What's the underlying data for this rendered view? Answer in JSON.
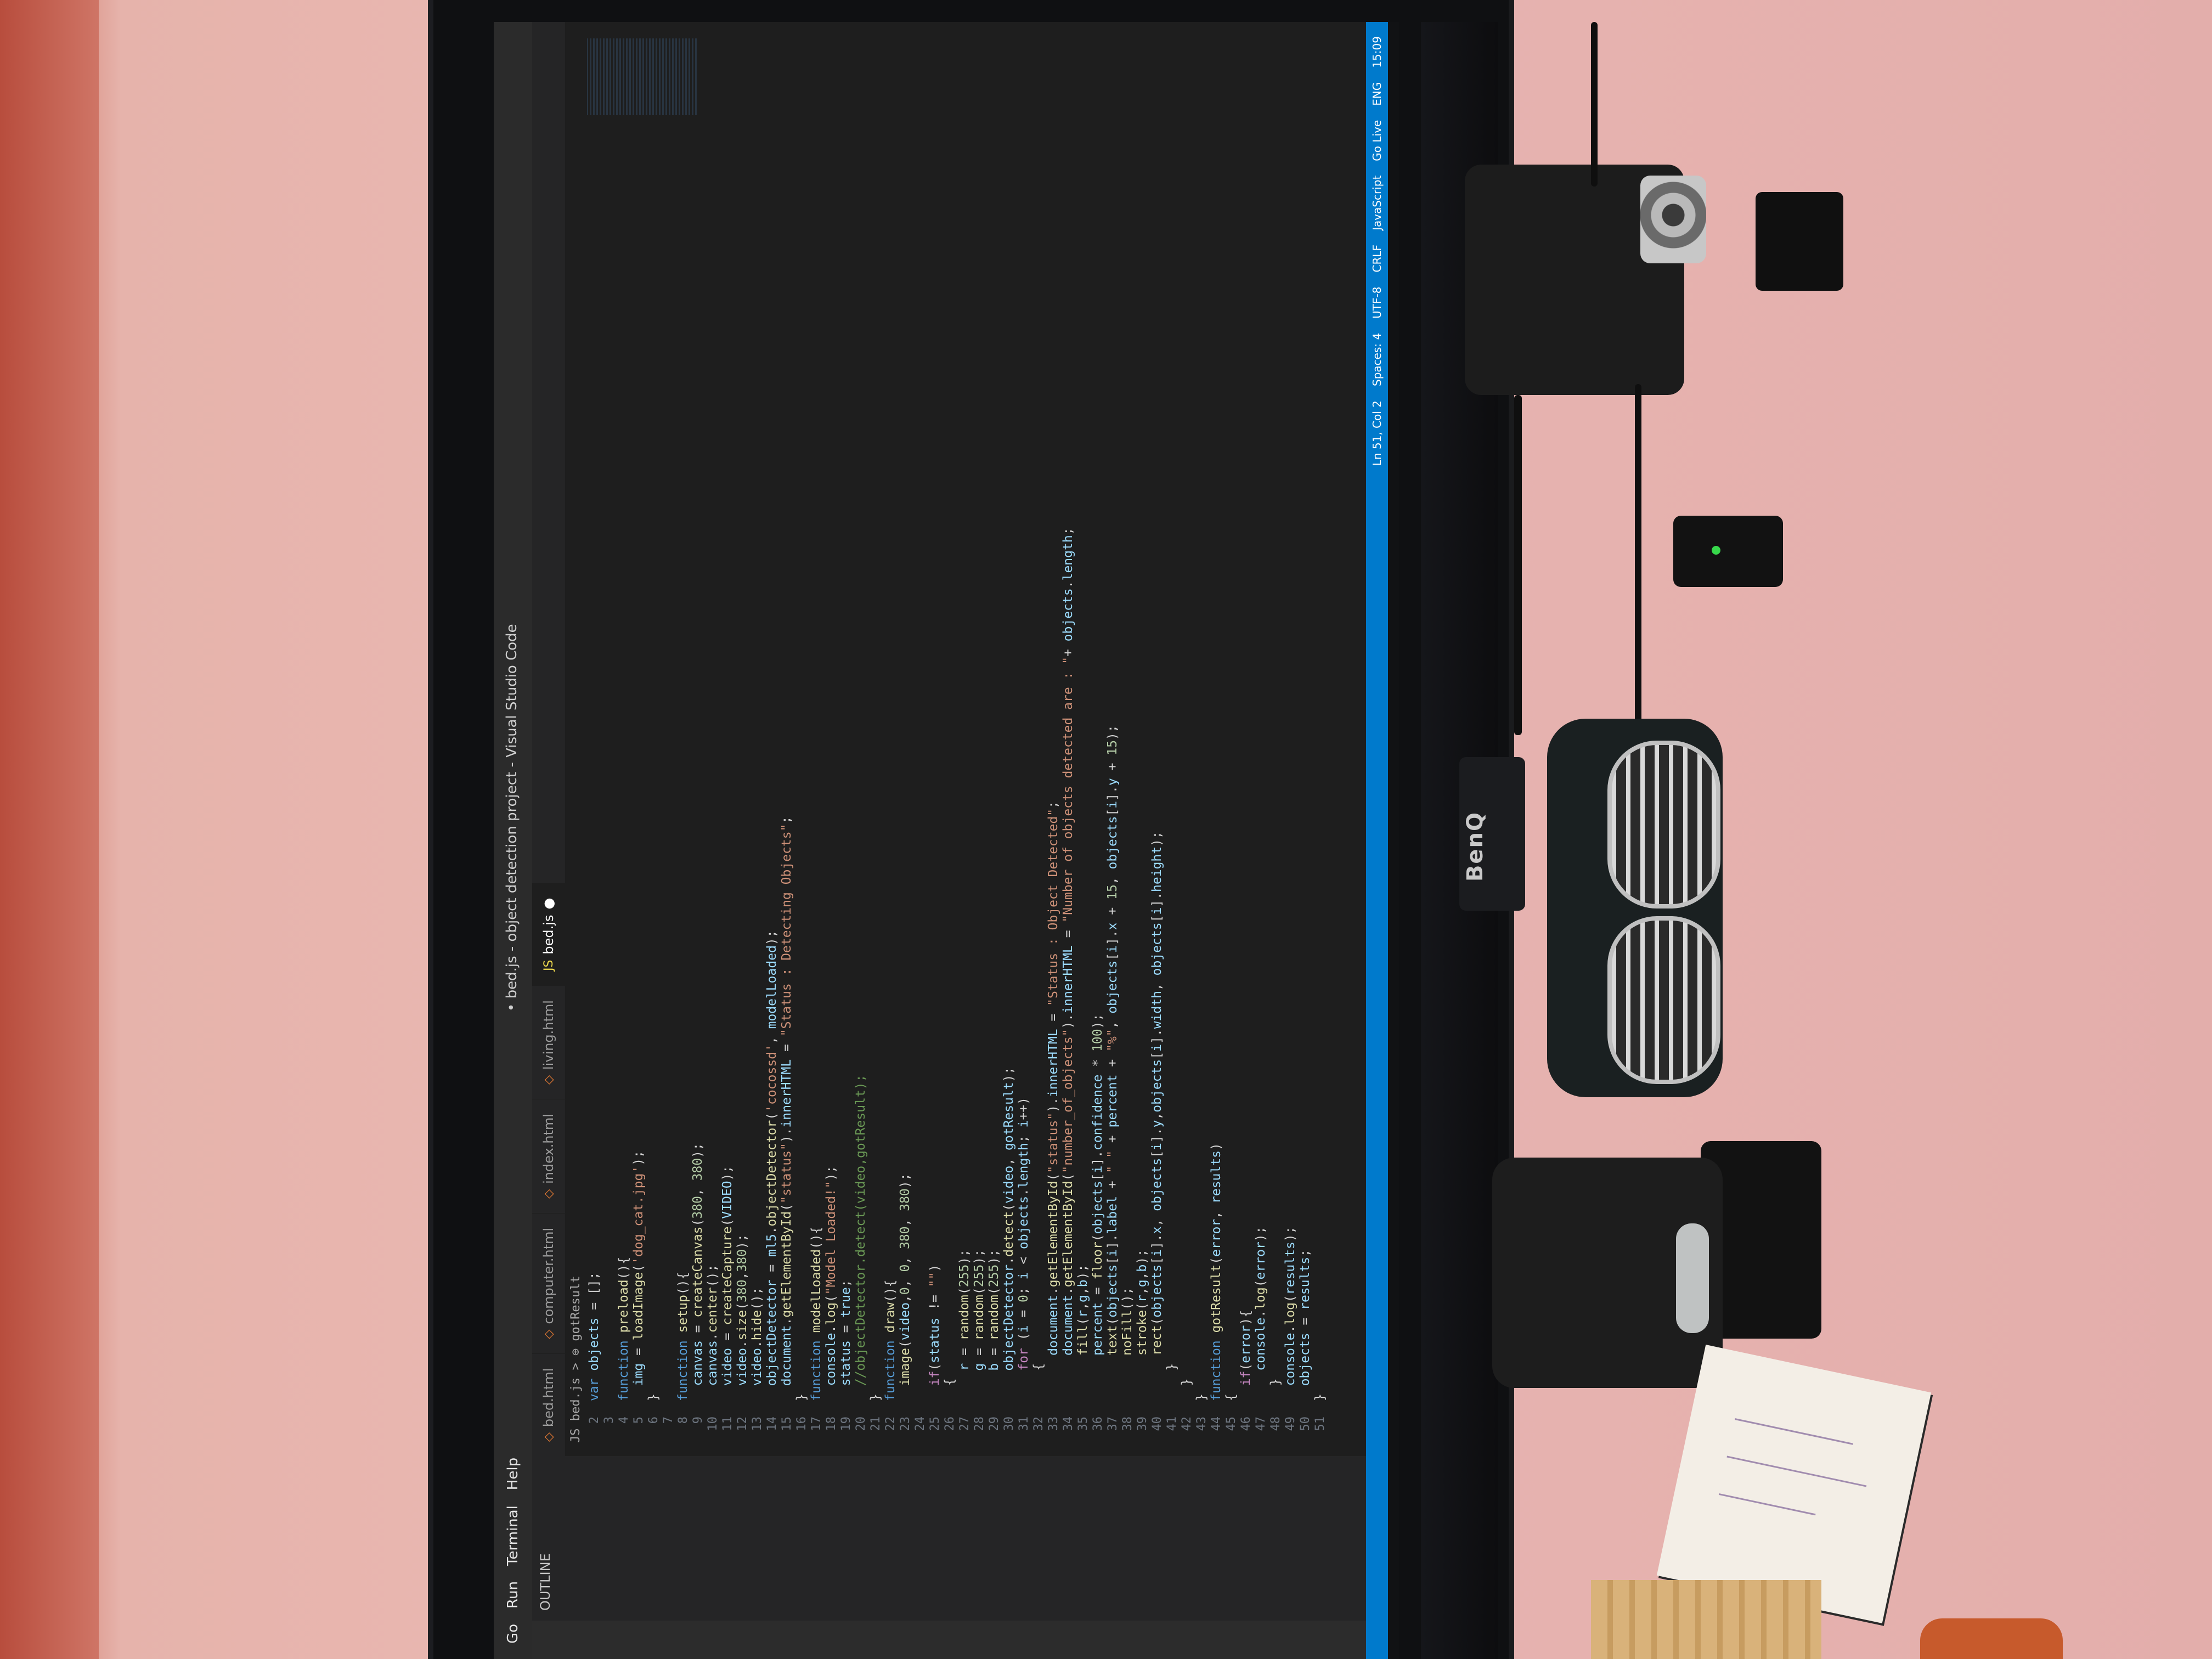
{
  "window": {
    "title": "• bed.js - object detection project - Visual Studio Code",
    "brand": "BenQ"
  },
  "menu": [
    "Go",
    "Run",
    "Terminal",
    "Help"
  ],
  "tabs": [
    {
      "label": "bed.html",
      "icon": "html-icon",
      "active": false
    },
    {
      "label": "computer.html",
      "icon": "html-icon",
      "active": false
    },
    {
      "label": "index.html",
      "icon": "html-icon",
      "active": false
    },
    {
      "label": "living.html",
      "icon": "html-icon",
      "active": false
    },
    {
      "label": "bed.js",
      "icon": "js-icon",
      "active": true
    }
  ],
  "breadcrumb": "JS bed.js > ⊕ gotResult",
  "code_lines": [
    {
      "n": "2",
      "text": "var objects = [];"
    },
    {
      "n": "3",
      "text": ""
    },
    {
      "n": "4",
      "text": "function preload(){"
    },
    {
      "n": "5",
      "text": "  img = loadImage('dog_cat.jpg');"
    },
    {
      "n": "6",
      "text": "}"
    },
    {
      "n": "7",
      "text": ""
    },
    {
      "n": "8",
      "text": "function setup(){"
    },
    {
      "n": "9",
      "text": "  canvas = createCanvas(380, 380);"
    },
    {
      "n": "10",
      "text": "  canvas.center();"
    },
    {
      "n": "11",
      "text": "  video = createCapture(VIDEO);"
    },
    {
      "n": "12",
      "text": "  video.size(380,380);"
    },
    {
      "n": "13",
      "text": "  video.hide();"
    },
    {
      "n": "14",
      "text": "  objectDetector = ml5.objectDetector('cocossd', modelLoaded);"
    },
    {
      "n": "15",
      "text": "  document.getElementById(\"status\").innerHTML = \"Status : Detecting Objects\";"
    },
    {
      "n": "16",
      "text": "}"
    },
    {
      "n": "17",
      "text": "function modelLoaded(){"
    },
    {
      "n": "18",
      "text": "  console.log(\"Model Loaded!\");"
    },
    {
      "n": "19",
      "text": "  status = true;"
    },
    {
      "n": "20",
      "text": "  //objectDetector.detect(video,gotResult);"
    },
    {
      "n": "21",
      "text": "}"
    },
    {
      "n": "22",
      "text": "function draw(){"
    },
    {
      "n": "23",
      "text": "  image(video,0, 0, 380, 380);"
    },
    {
      "n": "24",
      "text": ""
    },
    {
      "n": "25",
      "text": "  if(status != \"\")"
    },
    {
      "n": "26",
      "text": "  {"
    },
    {
      "n": "27",
      "text": "    r = random(255);"
    },
    {
      "n": "28",
      "text": "    g = random(255);"
    },
    {
      "n": "29",
      "text": "    b = random(255);"
    },
    {
      "n": "30",
      "text": "    objectDetector.detect(video, gotResult);"
    },
    {
      "n": "31",
      "text": "    for (i = 0; i < objects.length; i++)"
    },
    {
      "n": "32",
      "text": "    {"
    },
    {
      "n": "33",
      "text": "      document.getElementById(\"status\").innerHTML = \"Status : Object Detected\";"
    },
    {
      "n": "34",
      "text": "      document.getElementById(\"number_of_objects\").innerHTML = \"Number of objects detected are : \"+ objects.length;"
    },
    {
      "n": "35",
      "text": "      fill(r,g,b);"
    },
    {
      "n": "36",
      "text": "      percent = floor(objects[i].confidence * 100);"
    },
    {
      "n": "37",
      "text": "      text(objects[i].label + \" \" + percent + \"%\", objects[i].x + 15, objects[i].y + 15);"
    },
    {
      "n": "38",
      "text": "      noFill();"
    },
    {
      "n": "39",
      "text": "      stroke(r,g,b);"
    },
    {
      "n": "40",
      "text": "      rect(objects[i].x, objects[i].y,objects[i].width, objects[i].height);"
    },
    {
      "n": "41",
      "text": "    }"
    },
    {
      "n": "42",
      "text": "  }"
    },
    {
      "n": "43",
      "text": "}"
    },
    {
      "n": "44",
      "text": "function gotResult(error, results)"
    },
    {
      "n": "45",
      "text": "{"
    },
    {
      "n": "46",
      "text": "  if(error){"
    },
    {
      "n": "47",
      "text": "    console.log(error);"
    },
    {
      "n": "48",
      "text": "  }"
    },
    {
      "n": "49",
      "text": "  console.log(results);"
    },
    {
      "n": "50",
      "text": "  objects = results;"
    },
    {
      "n": "51",
      "text": "}"
    }
  ],
  "statusbar": {
    "position": "Ln 51, Col 2",
    "spaces": "Spaces: 4",
    "encoding": "UTF-8",
    "eol": "CRLF",
    "language": "JavaScript",
    "golive": "Go Live",
    "lang_code": "ENG",
    "time": "15:09"
  },
  "sidebar_outline": "OUTLINE",
  "colors": {
    "statusbar": "#007acc",
    "editor_bg": "#1e1e1e",
    "keyword": "#569cd6",
    "function": "#dcdcaa",
    "string": "#ce9178"
  }
}
